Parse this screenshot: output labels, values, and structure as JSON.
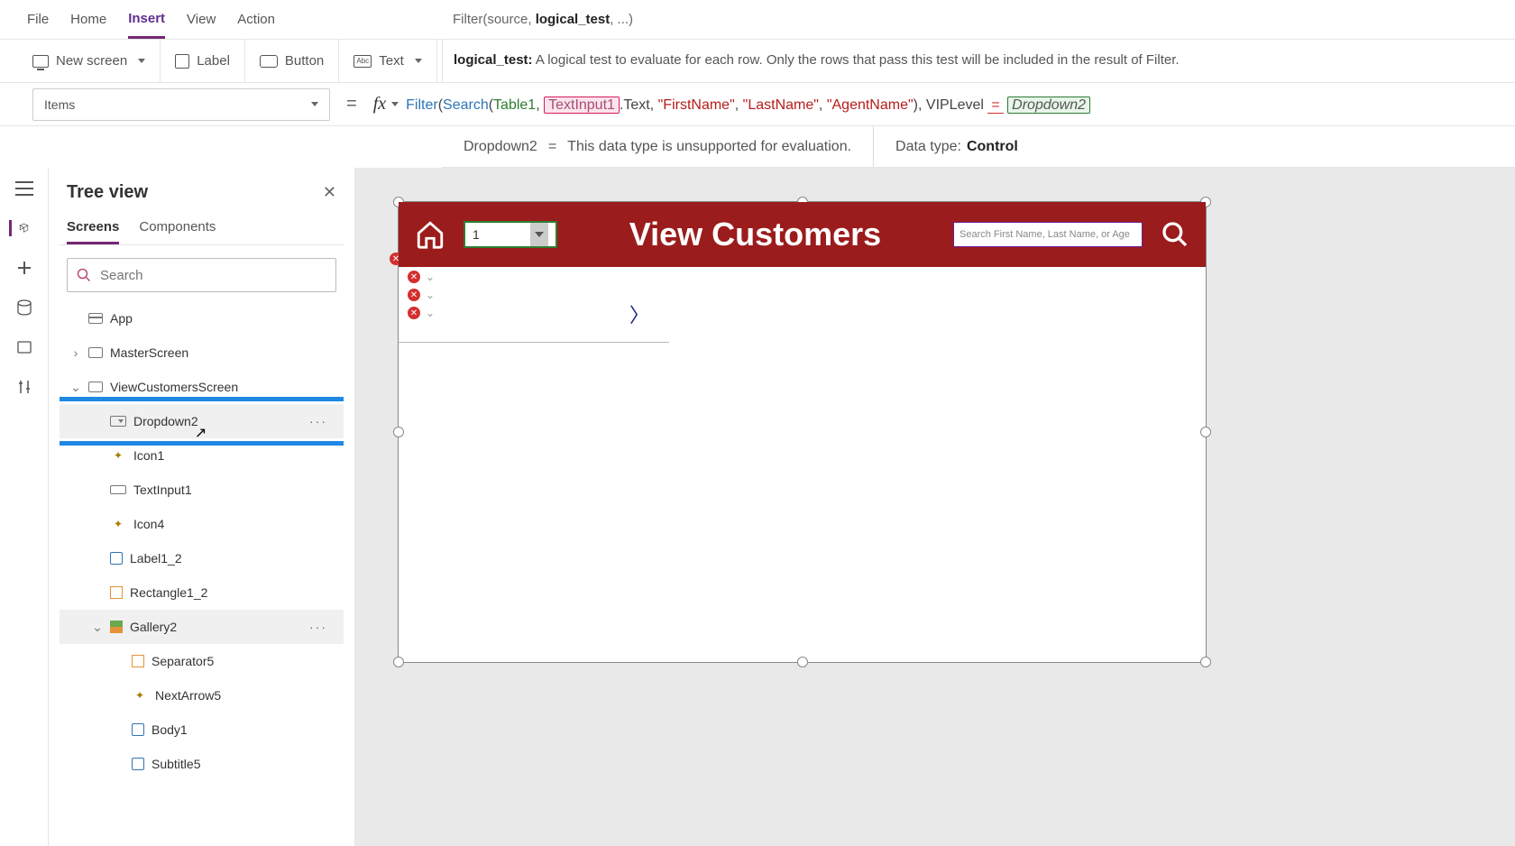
{
  "menu": {
    "items": [
      "File",
      "Home",
      "Insert",
      "View",
      "Action"
    ],
    "active": "Insert",
    "signature": {
      "pre": "Filter(source, ",
      "bold": "logical_test",
      "post": ", ...)"
    }
  },
  "ribbon": {
    "new_screen": "New screen",
    "label": "Label",
    "button": "Button",
    "text": "Text",
    "desc": {
      "bold": "logical_test:",
      "rest": " A logical test to evaluate for each row. Only the rows that pass this test will be included in the result of Filter."
    }
  },
  "property": {
    "selected": "Items",
    "formula_tokens": [
      {
        "t": "fn",
        "v": "Filter"
      },
      {
        "t": "txt",
        "v": "("
      },
      {
        "t": "fn",
        "v": "Search"
      },
      {
        "t": "txt",
        "v": "("
      },
      {
        "t": "src",
        "v": "Table1"
      },
      {
        "t": "txt",
        "v": ", "
      },
      {
        "t": "inp",
        "v": "TextInput1"
      },
      {
        "t": "txt",
        "v": ".Text, "
      },
      {
        "t": "str",
        "v": "\"FirstName\""
      },
      {
        "t": "txt",
        "v": ", "
      },
      {
        "t": "str",
        "v": "\"LastName\""
      },
      {
        "t": "txt",
        "v": ", "
      },
      {
        "t": "str",
        "v": "\"AgentName\""
      },
      {
        "t": "txt",
        "v": "), VIPLevel "
      },
      {
        "t": "eq",
        "v": "="
      },
      {
        "t": "txt",
        "v": " "
      },
      {
        "t": "box",
        "v": "Dropdown2"
      }
    ]
  },
  "info": {
    "left": {
      "lead": "Dropdown2",
      "op": "=",
      "msg": "This data type is unsupported for evaluation."
    },
    "right": {
      "label": "Data type:",
      "value": "Control"
    }
  },
  "tree": {
    "title": "Tree view",
    "tabs": [
      "Screens",
      "Components"
    ],
    "search_placeholder": "Search",
    "items": [
      {
        "depth": 0,
        "expander": "",
        "icon": "app",
        "label": "App"
      },
      {
        "depth": 0,
        "expander": ">",
        "icon": "screen",
        "label": "MasterScreen"
      },
      {
        "depth": 0,
        "expander": "v",
        "icon": "screen",
        "label": "ViewCustomersScreen"
      },
      {
        "depth": 1,
        "expander": "",
        "icon": "dd",
        "label": "Dropdown2",
        "selected": true,
        "dots": true,
        "highlight": true
      },
      {
        "depth": 1,
        "expander": "",
        "icon": "gen",
        "label": "Icon1"
      },
      {
        "depth": 1,
        "expander": "",
        "icon": "input",
        "label": "TextInput1"
      },
      {
        "depth": 1,
        "expander": "",
        "icon": "gen",
        "label": "Icon4"
      },
      {
        "depth": 1,
        "expander": "",
        "icon": "lbl",
        "label": "Label1_2"
      },
      {
        "depth": 1,
        "expander": "",
        "icon": "rect",
        "label": "Rectangle1_2"
      },
      {
        "depth": 1,
        "expander": "v",
        "icon": "gal",
        "label": "Gallery2",
        "selected2": true,
        "dots": true
      },
      {
        "depth": 2,
        "expander": "",
        "icon": "rect",
        "label": "Separator5"
      },
      {
        "depth": 2,
        "expander": "",
        "icon": "gen",
        "label": "NextArrow5"
      },
      {
        "depth": 2,
        "expander": "",
        "icon": "lbl",
        "label": "Body1"
      },
      {
        "depth": 2,
        "expander": "",
        "icon": "lbl",
        "label": "Subtitle5"
      }
    ]
  },
  "canvas": {
    "header_title": "View Customers",
    "dropdown_value": "1",
    "search_placeholder": "Search First Name, Last Name, or Age"
  }
}
